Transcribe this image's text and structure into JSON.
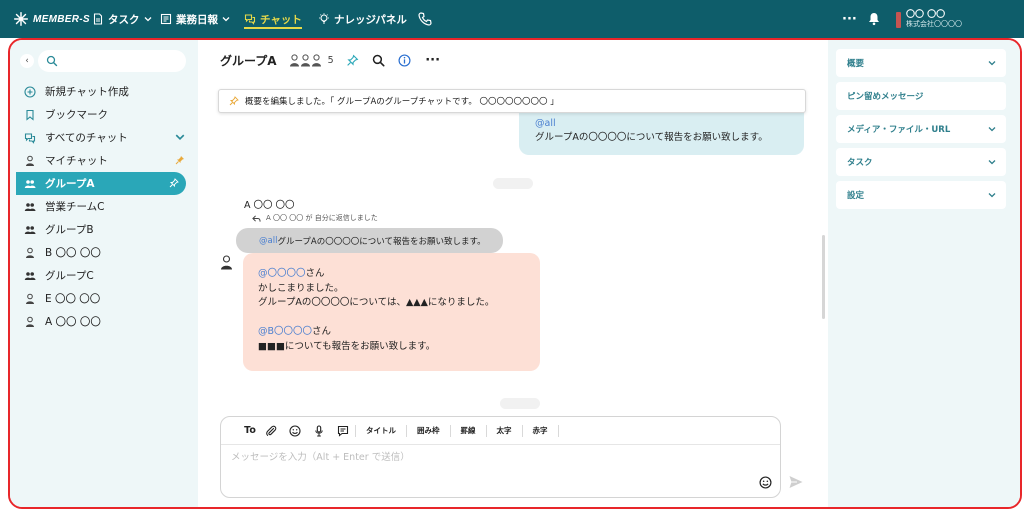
{
  "app": {
    "logo_text": "MEMBER-S"
  },
  "topnav": {
    "items": [
      {
        "label": "タスク"
      },
      {
        "label": "業務日報"
      },
      {
        "label": "チャット"
      },
      {
        "label": "ナレッジパネル"
      }
    ],
    "more_label": "···",
    "user": {
      "name": "〇〇 〇〇",
      "company": "株式会社〇〇〇〇"
    }
  },
  "sidebar": {
    "collapse_label": "‹",
    "search_placeholder": "",
    "items": [
      {
        "label": "新規チャット作成"
      },
      {
        "label": "ブックマーク"
      },
      {
        "label": "すべてのチャット"
      },
      {
        "label": "マイチャット"
      },
      {
        "label": "グループA"
      },
      {
        "label": "営業チームC"
      },
      {
        "label": "グループB"
      },
      {
        "label": "B 〇〇 〇〇"
      },
      {
        "label": "グループC"
      },
      {
        "label": "E 〇〇 〇〇"
      },
      {
        "label": "A 〇〇 〇〇"
      }
    ]
  },
  "chat": {
    "title": "グループA",
    "member_count": "5",
    "more_label": "···",
    "notice": "概要を編集しました。「 グループAのグループチャットです。 〇〇〇〇〇〇〇〇 」",
    "messages": {
      "own": {
        "mention": "@all",
        "text": "グループAの〇〇〇〇について報告をお願い致します。"
      },
      "reply": {
        "sender": "A 〇〇 〇〇",
        "reply_note": "A 〇〇 〇〇 が 自分に返信しました",
        "quote_mention": "@all",
        "quote_text": " グループAの〇〇〇〇について報告をお願い致します。",
        "line1_mention": "@〇〇〇〇",
        "line1_suffix": "さん",
        "line2": "かしこまりました。",
        "line3": "グループAの〇〇〇〇については、▲▲▲になりました。",
        "line4_mention": "@B〇〇〇〇",
        "line4_suffix": "さん",
        "line5": "■■■についても報告をお願い致します。"
      }
    }
  },
  "composer": {
    "to_label": "To",
    "format_buttons": [
      "タイトル",
      "囲み枠",
      "罫線",
      "太字",
      "赤字"
    ],
    "placeholder": "メッセージを入力（Alt + Enter で送信）"
  },
  "right_panel": {
    "sections": [
      {
        "label": "概要"
      },
      {
        "label": "ピン留めメッセージ"
      },
      {
        "label": "メディア・ファイル・URL"
      },
      {
        "label": "タスク"
      },
      {
        "label": "設定"
      }
    ]
  },
  "colors": {
    "topbar": "#0e5d6a",
    "accent": "#2aa7b8",
    "active_nav": "#e6d94a",
    "own_bubble": "#d9eef2",
    "other_bubble": "#fde0d6",
    "highlight_border": "#e8262a"
  }
}
